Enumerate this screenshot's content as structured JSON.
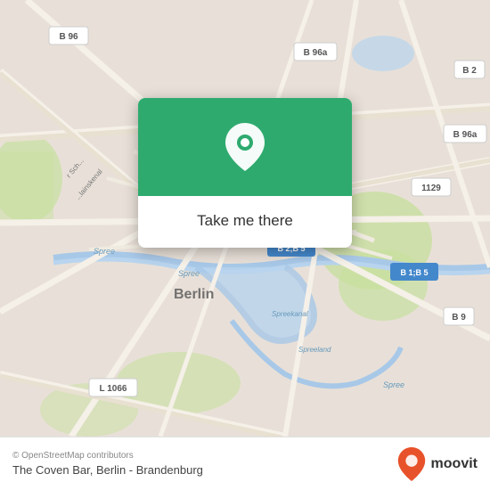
{
  "map": {
    "attribution": "© OpenStreetMap contributors",
    "location_label": "The Coven Bar, Berlin - Brandenburg",
    "popup": {
      "button_label": "Take me there"
    },
    "accent_color": "#2eaa6e"
  },
  "moovit": {
    "logo_text": "moovit",
    "pin_color": "#e8522a"
  }
}
